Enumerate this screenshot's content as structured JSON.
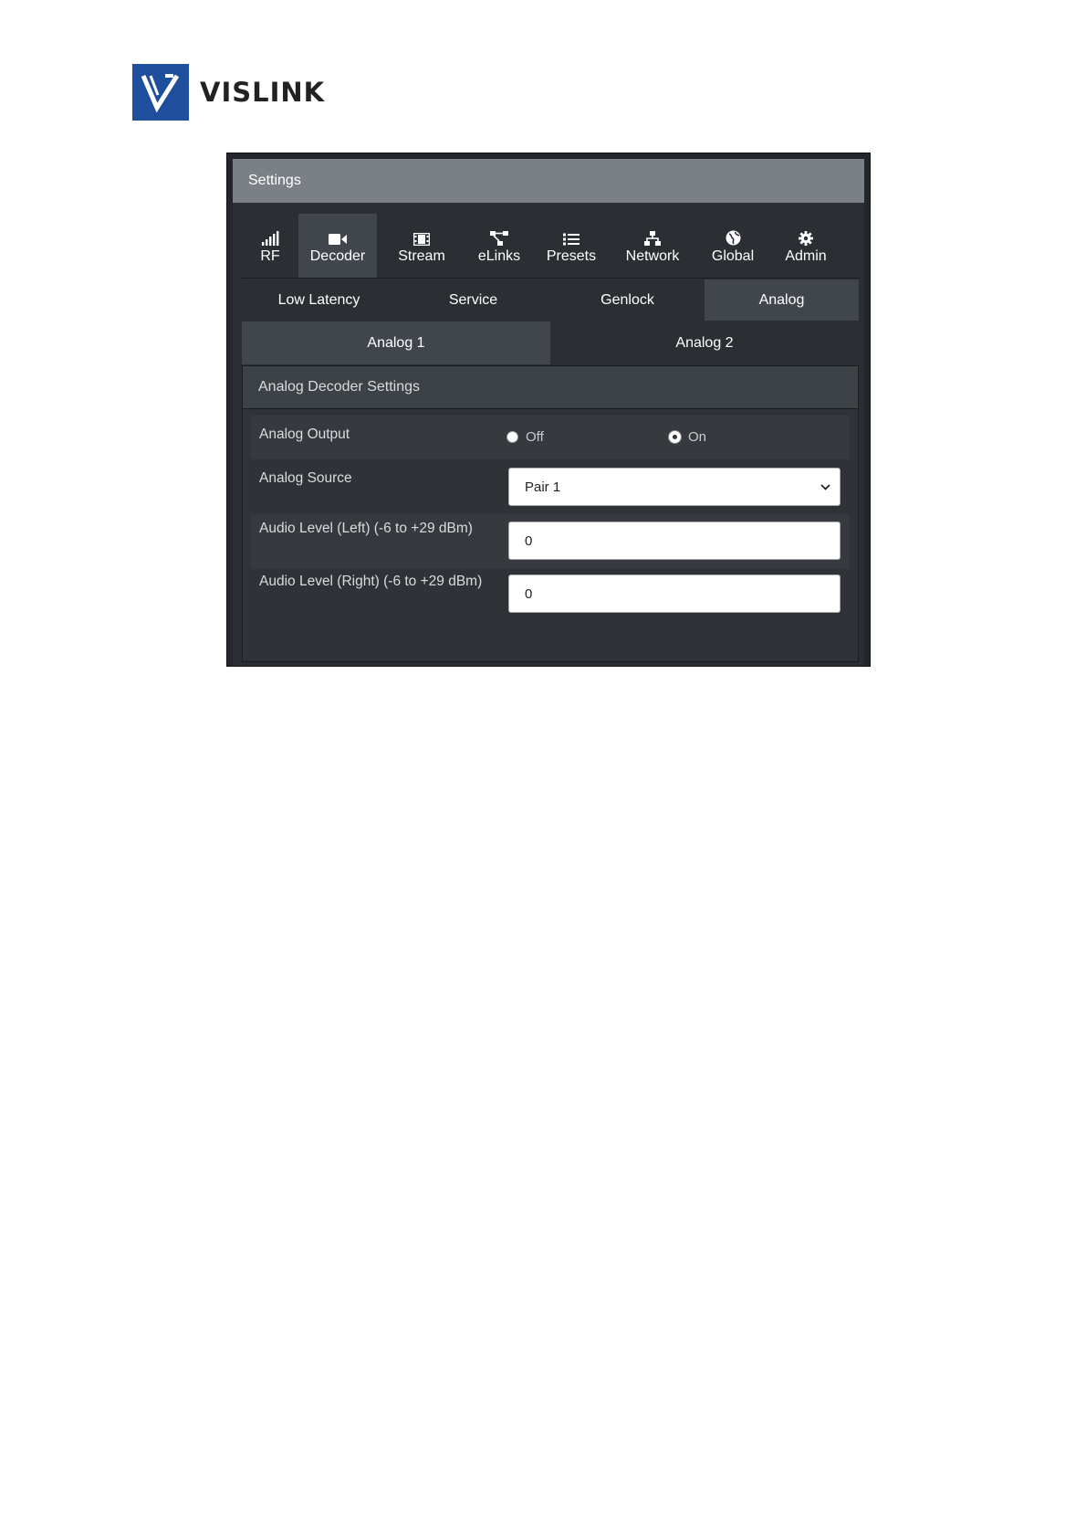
{
  "brand": {
    "name": "VISLINK"
  },
  "panel": {
    "title": "Settings"
  },
  "main_nav": [
    {
      "label": "RF",
      "icon": "signal-bars-icon"
    },
    {
      "label": "Decoder",
      "icon": "video-camera-icon"
    },
    {
      "label": "Stream",
      "icon": "film-icon"
    },
    {
      "label": "eLinks",
      "icon": "links-icon"
    },
    {
      "label": "Presets",
      "icon": "list-icon"
    },
    {
      "label": "Network",
      "icon": "network-icon"
    },
    {
      "label": "Global",
      "icon": "globe-icon"
    },
    {
      "label": "Admin",
      "icon": "gear-icon"
    }
  ],
  "main_nav_active": "Decoder",
  "sub_tabs": [
    "Low Latency",
    "Service",
    "Genlock",
    "Analog"
  ],
  "sub_tab_active": "Analog",
  "analog_tabs": [
    "Analog 1",
    "Analog 2"
  ],
  "analog_tab_active": "Analog 1",
  "settings": {
    "title": "Analog Decoder Settings",
    "analog_output": {
      "label": "Analog Output",
      "options": [
        "Off",
        "On"
      ],
      "selected": "On"
    },
    "analog_source": {
      "label": "Analog Source",
      "value": "Pair 1"
    },
    "audio_left": {
      "label": "Audio Level (Left) (-6 to +29 dBm)",
      "value": "0"
    },
    "audio_right": {
      "label": "Audio Level (Right) (-6 to +29 dBm)",
      "value": "0"
    }
  }
}
